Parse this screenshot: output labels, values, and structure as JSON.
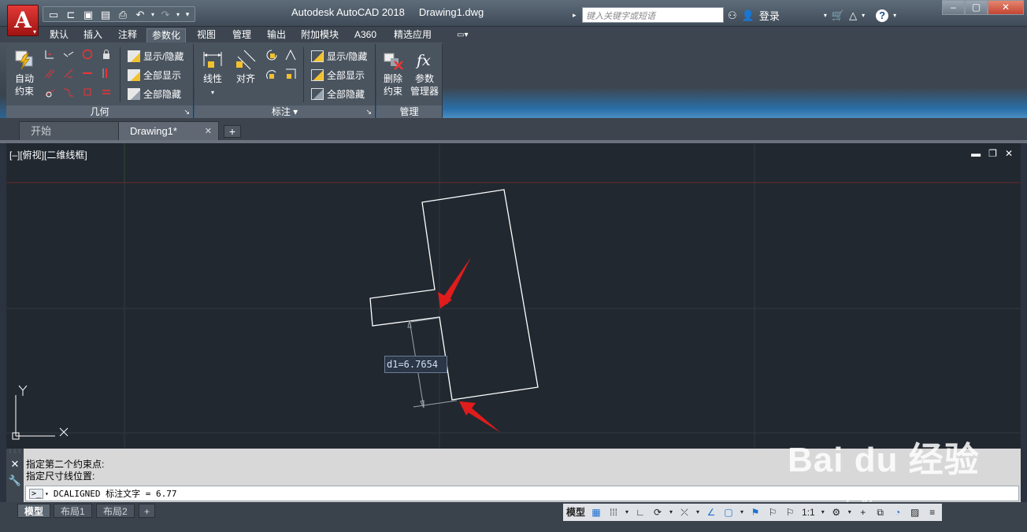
{
  "titlebar": {
    "app_letter": "A",
    "title": "Autodesk AutoCAD 2018",
    "filename": "Drawing1.dwg",
    "search_placeholder": "键入关键字或短语",
    "login": "登录",
    "help": "?"
  },
  "ribbon_tabs": [
    "默认",
    "插入",
    "注释",
    "参数化",
    "视图",
    "管理",
    "输出",
    "附加模块",
    "A360",
    "精选应用"
  ],
  "active_tab": "参数化",
  "panels": {
    "geometry": {
      "label": "几何",
      "auto_constrain": "自动\n约束",
      "show_hide": "显示/隐藏",
      "show_all": "全部显示",
      "hide_all": "全部隐藏"
    },
    "dimension": {
      "label": "标注",
      "linear": "线性",
      "aligned": "对齐",
      "show_hide": "显示/隐藏",
      "show_all": "全部显示",
      "hide_all": "全部隐藏"
    },
    "manage": {
      "label": "管理",
      "delete_constraints": "删除\n约束",
      "param_manager": "参数\n管理器"
    }
  },
  "doc_tabs": [
    {
      "label": "开始",
      "active": false
    },
    {
      "label": "Drawing1*",
      "active": true
    }
  ],
  "viewport": {
    "label": "[–][俯视][二维线框]",
    "ucs_x": "X",
    "ucs_y": "Y",
    "dimension_text": "d1=6.7654"
  },
  "command": {
    "history": [
      "指定第二个约束点:",
      "指定尺寸线位置:"
    ],
    "current": "DCALIGNED 标注文字 = 6.77"
  },
  "layout_tabs": [
    "模型",
    "布局1",
    "布局2"
  ],
  "status": {
    "model": "模型",
    "scale": "1:1"
  },
  "watermark": {
    "brand": "Bai du 经验",
    "url": "jingyan.baidu.com"
  },
  "colors": {
    "accent_red": "#e02020",
    "canvas": "#212830",
    "grid": "#2c343d"
  }
}
